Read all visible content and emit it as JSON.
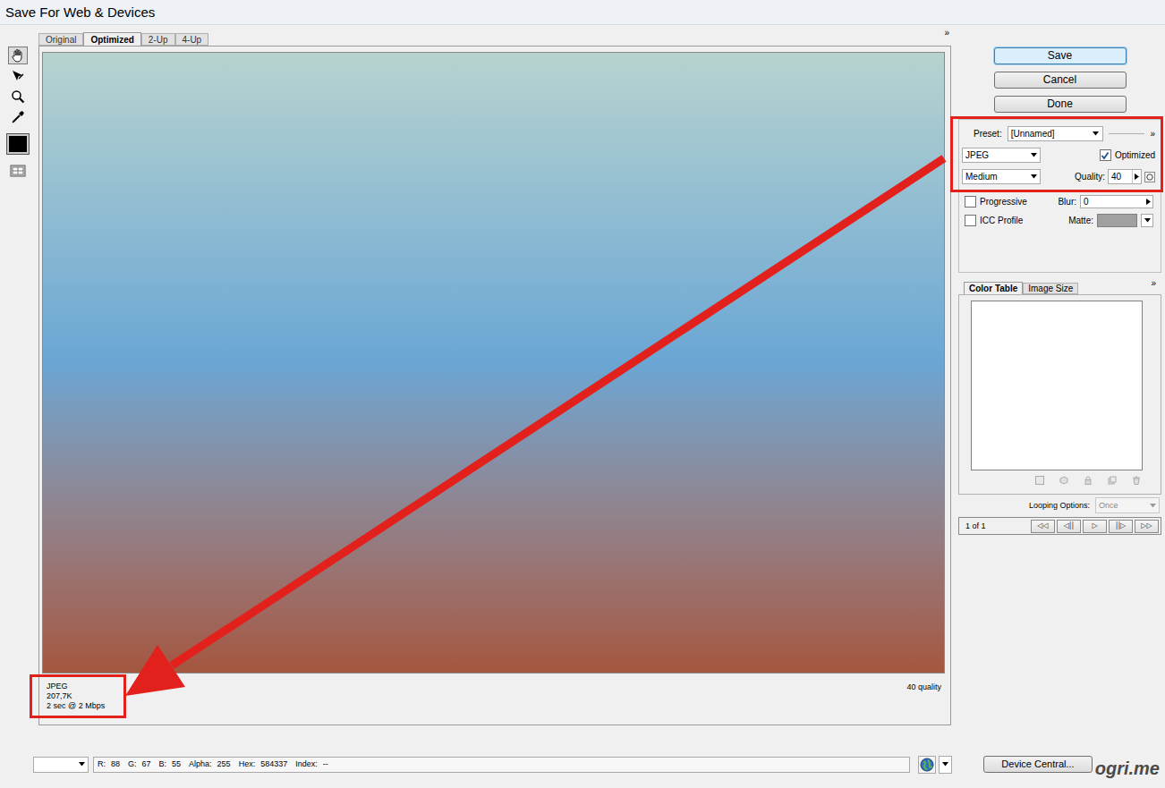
{
  "window": {
    "title": "Save For Web & Devices"
  },
  "tools": [
    {
      "selected": true
    },
    {
      "selected": false
    },
    {
      "selected": false
    },
    {
      "selected": false
    },
    {
      "selected": false
    }
  ],
  "view_tabs": [
    {
      "label": "Original",
      "selected": false
    },
    {
      "label": "Optimized",
      "selected": true
    },
    {
      "label": "2-Up",
      "selected": false
    },
    {
      "label": "4-Up",
      "selected": false
    }
  ],
  "view_menu": "»",
  "preview_info": {
    "format": "JPEG",
    "file_size": "207,7K",
    "download_time": "2 sec @ 2 Mbps",
    "quality_note": "40 quality"
  },
  "buttons": [
    {
      "label": "Save",
      "default": true
    },
    {
      "label": "Cancel",
      "default": false
    },
    {
      "label": "Done",
      "default": false
    }
  ],
  "settings": {
    "preset_label": "Preset:",
    "preset": "[Unnamed]",
    "menu": "»",
    "format": "JPEG",
    "optimized": {
      "label": "Optimized",
      "checked": true
    },
    "compression": "Medium",
    "quality_label": "Quality:",
    "quality": "40",
    "progressive": {
      "label": "Progressive",
      "checked": false
    },
    "blur_label": "Blur:",
    "blur": "0",
    "icc_profile": {
      "label": "ICC Profile",
      "checked": false
    },
    "matte_label": "Matte:"
  },
  "panel_tabs": [
    {
      "label": "Color Table",
      "selected": true
    },
    {
      "label": "Image Size",
      "selected": false
    }
  ],
  "panel_menu": "»",
  "looping": {
    "label": "Looping Options:",
    "value": "Once",
    "disabled": true
  },
  "animation": {
    "frame": "1 of 1",
    "controls": [
      "◁◁",
      "◁||",
      "▷",
      "||▷",
      "▷▷"
    ]
  },
  "status_bar": {
    "fields": [
      {
        "label": "R:",
        "value": "88"
      },
      {
        "label": "G:",
        "value": "67"
      },
      {
        "label": "B:",
        "value": "55"
      },
      {
        "label": "Alpha:",
        "value": "255"
      },
      {
        "label": "Hex:",
        "value": "584337"
      },
      {
        "label": "Index:",
        "value": "--"
      }
    ]
  },
  "device_central": "Device Central...",
  "watermark": "ogri.me"
}
